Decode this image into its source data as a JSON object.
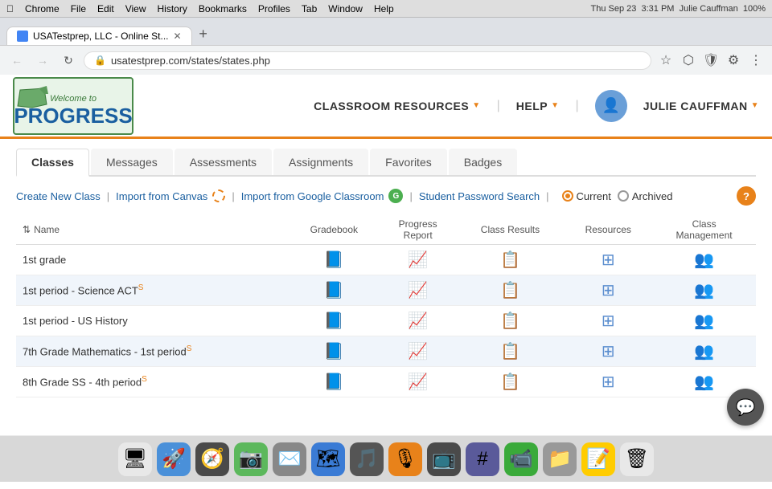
{
  "mac_menubar": {
    "apple": "&#63743;",
    "items": [
      "Chrome",
      "File",
      "Edit",
      "View",
      "History",
      "Bookmarks",
      "Profiles",
      "Tab",
      "Window",
      "Help"
    ],
    "right_info": "Thu Sep 23  3:31 PM  Julie Cauffman  100%"
  },
  "browser": {
    "tab_title": "USATestprep, LLC - Online St...",
    "url": "usatestprep.com/states/states.php",
    "new_tab_label": "+"
  },
  "header": {
    "logo_welcome": "Welcome to",
    "logo_name": "PROGRESS",
    "nav_items": [
      {
        "label": "CLASSROOM RESOURCES",
        "caret": "▼"
      },
      {
        "label": "HELP",
        "caret": "▼"
      },
      {
        "label": "JULIE CAUFFMAN",
        "caret": "▼"
      }
    ],
    "divider": "|"
  },
  "tabs": {
    "items": [
      "Classes",
      "Messages",
      "Assessments",
      "Assignments",
      "Favorites",
      "Badges"
    ],
    "active": "Classes"
  },
  "action_bar": {
    "create_class": "Create New Class",
    "sep1": "|",
    "import_canvas": "Import from Canvas",
    "sep2": "|",
    "import_google": "Import from Google Classroom",
    "sep3": "|",
    "password_search": "Student Password Search",
    "sep4": "|",
    "current_label": "Current",
    "archived_label": "Archived"
  },
  "table": {
    "columns": [
      {
        "label": "Name",
        "key": "name"
      },
      {
        "label": "Gradebook",
        "key": "gradebook"
      },
      {
        "label": "Progress\nReport",
        "key": "progress"
      },
      {
        "label": "Class Results",
        "key": "results"
      },
      {
        "label": "Resources",
        "key": "resources"
      },
      {
        "label": "Class\nManagement",
        "key": "management"
      }
    ],
    "rows": [
      {
        "name": "1st grade",
        "superscript": ""
      },
      {
        "name": "1st period - Science ACT",
        "superscript": "S"
      },
      {
        "name": "1st period - US History",
        "superscript": ""
      },
      {
        "name": "7th Grade Mathematics - 1st period",
        "superscript": "S"
      },
      {
        "name": "8th Grade SS - 4th period",
        "superscript": "S"
      }
    ]
  },
  "help_btn": "?",
  "chat_icon": "💬"
}
